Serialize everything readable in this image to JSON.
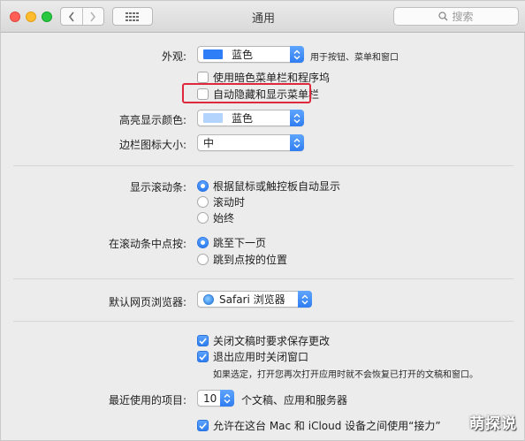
{
  "window": {
    "title": "通用"
  },
  "search": {
    "placeholder": "搜索"
  },
  "appearance": {
    "label": "外观:",
    "value": "蓝色",
    "note": "用于按钮、菜单和窗口",
    "color": "#2d7ef7"
  },
  "dark_menu": {
    "label": "使用暗色菜单栏和程序坞",
    "checked": false
  },
  "autohide_menu": {
    "label": "自动隐藏和显示菜单栏",
    "checked": false
  },
  "highlight_color": {
    "label": "高亮显示颜色:",
    "value": "蓝色",
    "color": "#b3d4fc"
  },
  "sidebar_icon_size": {
    "label": "边栏图标大小:",
    "value": "中"
  },
  "scrollbars": {
    "label": "显示滚动条:",
    "options": [
      "根据鼠标或触控板自动显示",
      "滚动时",
      "始终"
    ],
    "selected": 0
  },
  "scroll_click": {
    "label": "在滚动条中点按:",
    "options": [
      "跳至下一页",
      "跳到点按的位置"
    ],
    "selected": 0
  },
  "browser": {
    "label": "默认网页浏览器:",
    "value": "Safari 浏览器"
  },
  "close_docs": {
    "label": "关闭文稿时要求保存更改",
    "checked": true
  },
  "close_windows": {
    "label": "退出应用时关闭窗口",
    "checked": true
  },
  "close_windows_note": "如果选定，打开您再次打开应用时就不会恢复已打开的文稿和窗口。",
  "recent_items": {
    "label": "最近使用的项目:",
    "value": "10",
    "suffix": "个文稿、应用和服务器"
  },
  "handoff": {
    "label": "允许在这台 Mac 和 iCloud 设备之间使用“接力”",
    "checked": true
  },
  "watermark": "萌探说",
  "colors": {
    "accent": "#2f7df1",
    "highlight_box": "#e0283c"
  }
}
